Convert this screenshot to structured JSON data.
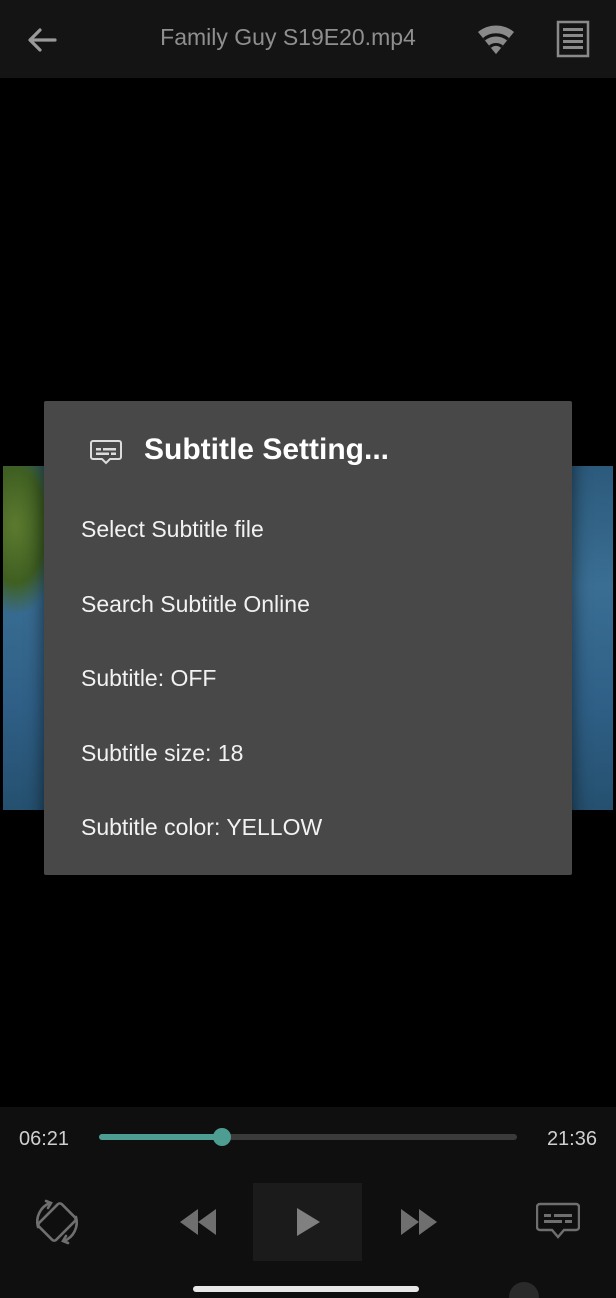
{
  "topbar": {
    "title": "Family Guy S19E20.mp4"
  },
  "dialog": {
    "title": "Subtitle Setting...",
    "items": [
      {
        "label": "Select Subtitle file"
      },
      {
        "label": "Search Subtitle Online"
      },
      {
        "label": "Subtitle: OFF"
      },
      {
        "label": "Subtitle size: 18"
      },
      {
        "label": "Subtitle color: YELLOW"
      }
    ]
  },
  "player": {
    "current_time": "06:21",
    "duration": "21:36",
    "progress": 0.294
  },
  "colors": {
    "accent": "#4e9d93",
    "dialog_bg": "#484848",
    "topbar_bg": "#141414"
  },
  "icons": {
    "back": "arrow-left-icon",
    "wifi": "wifi-icon",
    "menu": "list-menu-icon",
    "dialog": "subtitles-icon",
    "rotate": "screen-rotate-icon",
    "rewind": "rewind-icon",
    "play": "play-icon",
    "fast_forward": "fast-forward-icon",
    "subtitles": "subtitles-icon"
  }
}
